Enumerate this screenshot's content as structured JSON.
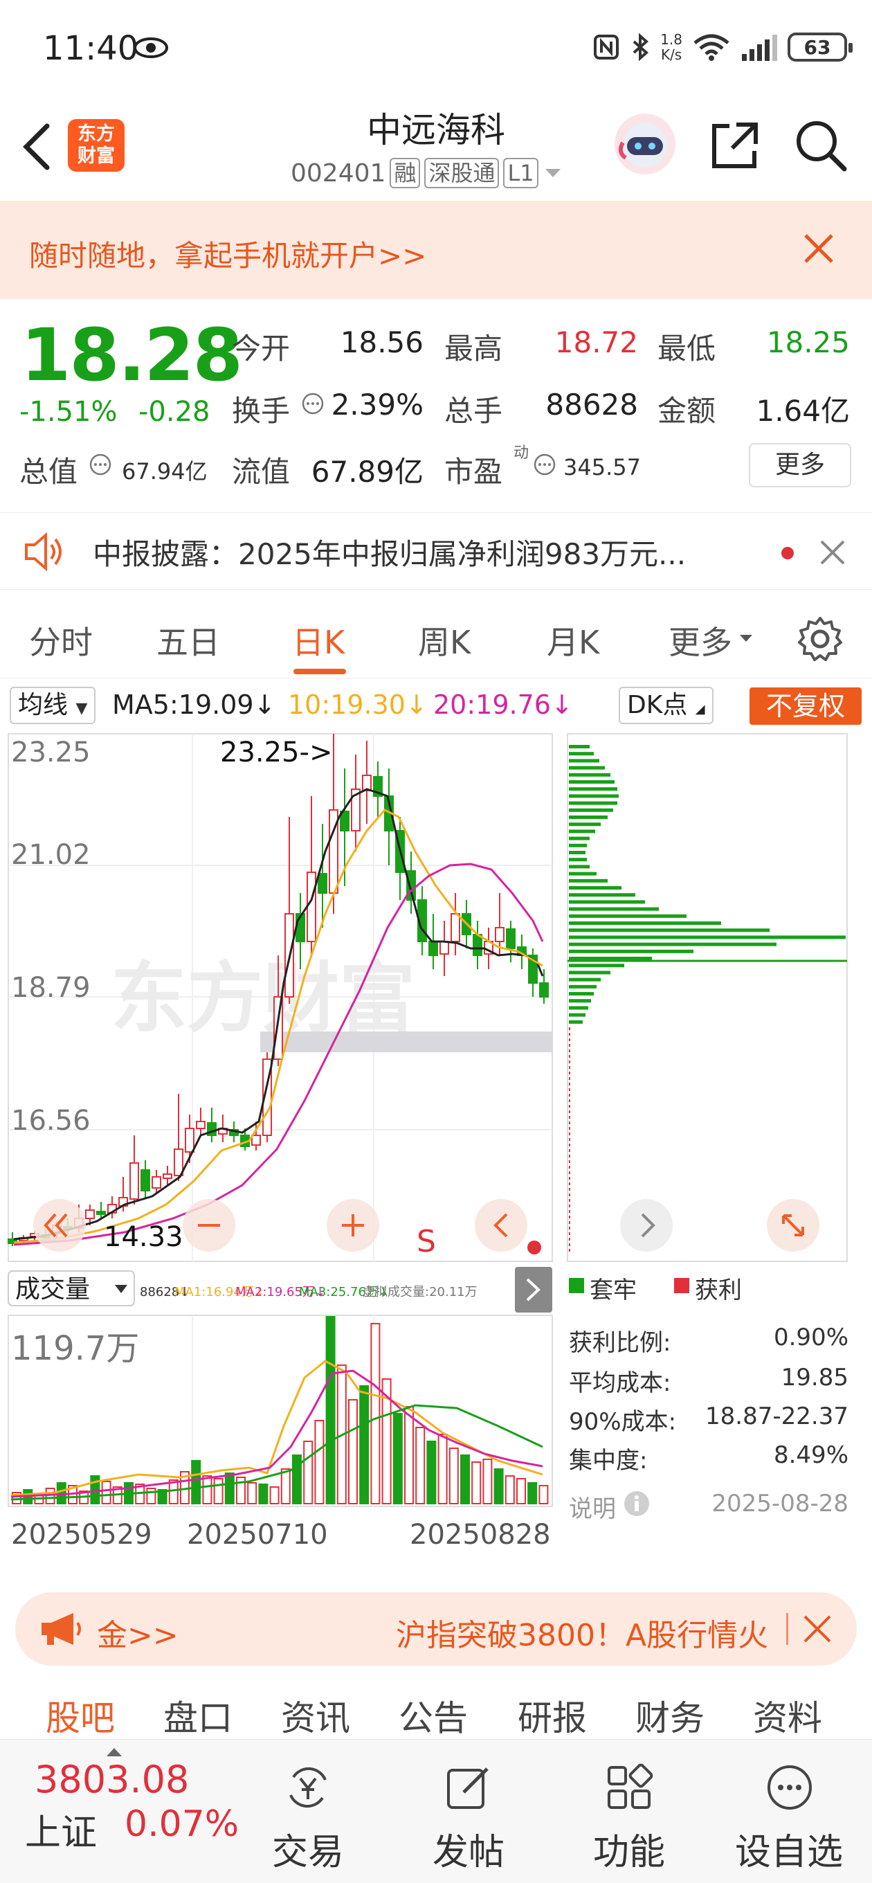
{
  "status_bar": {
    "time": "11:40",
    "net_speed_top": "1.8",
    "net_speed_bottom": "K/s",
    "battery": "63"
  },
  "header": {
    "app_logo_top": "东方",
    "app_logo_bottom": "财富",
    "stock_name": "中远海科",
    "stock_code": "002401",
    "tags": [
      "融",
      "深股通",
      "L1"
    ]
  },
  "banner": {
    "text": "随时随地，拿起手机就开户>>"
  },
  "quote": {
    "price": "18.28",
    "change_pct": "-1.51%",
    "change_amt": "-0.28",
    "open_label": "今开",
    "open_value": "18.56",
    "high_label": "最高",
    "high_value": "18.72",
    "low_label": "最低",
    "low_value": "18.25",
    "turnover_label": "换手",
    "turnover_value": "2.39%",
    "volume_label": "总手",
    "volume_value": "88628",
    "amount_label": "金额",
    "amount_value": "1.64亿",
    "mktcap_label": "总值",
    "mktcap_value": "67.94亿",
    "float_label": "流值",
    "float_value": "67.89亿",
    "pe_label": "市盈",
    "pe_superscript": "动",
    "pe_value": "345.57",
    "more_label": "更多"
  },
  "notice": {
    "text": "中报披露：2025年中报归属净利润983万元..."
  },
  "tabs": [
    {
      "label": "分时"
    },
    {
      "label": "五日"
    },
    {
      "label": "日K"
    },
    {
      "label": "周K"
    },
    {
      "label": "月K"
    },
    {
      "label": "更多"
    }
  ],
  "ma_row": {
    "selector": "均线",
    "ma5": "MA5:19.09↓",
    "ma10": "10:19.30↓",
    "ma20": "20:19.76↓",
    "dk": "DK点",
    "fuquan": "不复权"
  },
  "kline": {
    "price_labels": [
      "23.25",
      "21.02",
      "18.79",
      "16.56"
    ],
    "high_annotation": "23.25->",
    "low_annotation": "14.33",
    "watermark": "东方财富",
    "sell_marker": "S"
  },
  "volume": {
    "selector": "成交量",
    "legend_vol": "88628↓",
    "legend_ma1": "MA1:16.94万↓",
    "legend_ma2": "MA2:19.65万↓",
    "legend_ma3": "MA3:25.76万↓",
    "legend_virtual": "虚拟成交量:20.11万",
    "max_label": "119.7万",
    "dates": [
      "20250529",
      "20250710",
      "20250828"
    ]
  },
  "chip": {
    "legend_trapped": "套牢",
    "legend_profit": "获利",
    "rows": [
      {
        "label": "获利比例:",
        "value": "0.90%"
      },
      {
        "label": "平均成本:",
        "value": "19.85"
      },
      {
        "label": "90%成本:",
        "value": "18.87-22.37"
      },
      {
        "label": "集中度:",
        "value": "8.49%"
      }
    ],
    "note_label": "说明",
    "date": "2025-08-28"
  },
  "promo": {
    "left": "金>>",
    "right": "沪指突破3800！A股行情火"
  },
  "sub_tabs": [
    "股吧",
    "盘口",
    "资讯",
    "公告",
    "研报",
    "财务",
    "资料"
  ],
  "bottom_nav": {
    "index_value": "3803.08",
    "index_name": "上证",
    "index_change": "0.07%",
    "items": [
      {
        "label": "交易"
      },
      {
        "label": "发帖"
      },
      {
        "label": "功能"
      },
      {
        "label": "设自选"
      }
    ]
  },
  "colors": {
    "up": "#e0303a",
    "down": "#19a019",
    "accent": "#ec6028",
    "ma5": "#222222",
    "ma10": "#f2b01e",
    "ma20": "#d6249f"
  }
}
